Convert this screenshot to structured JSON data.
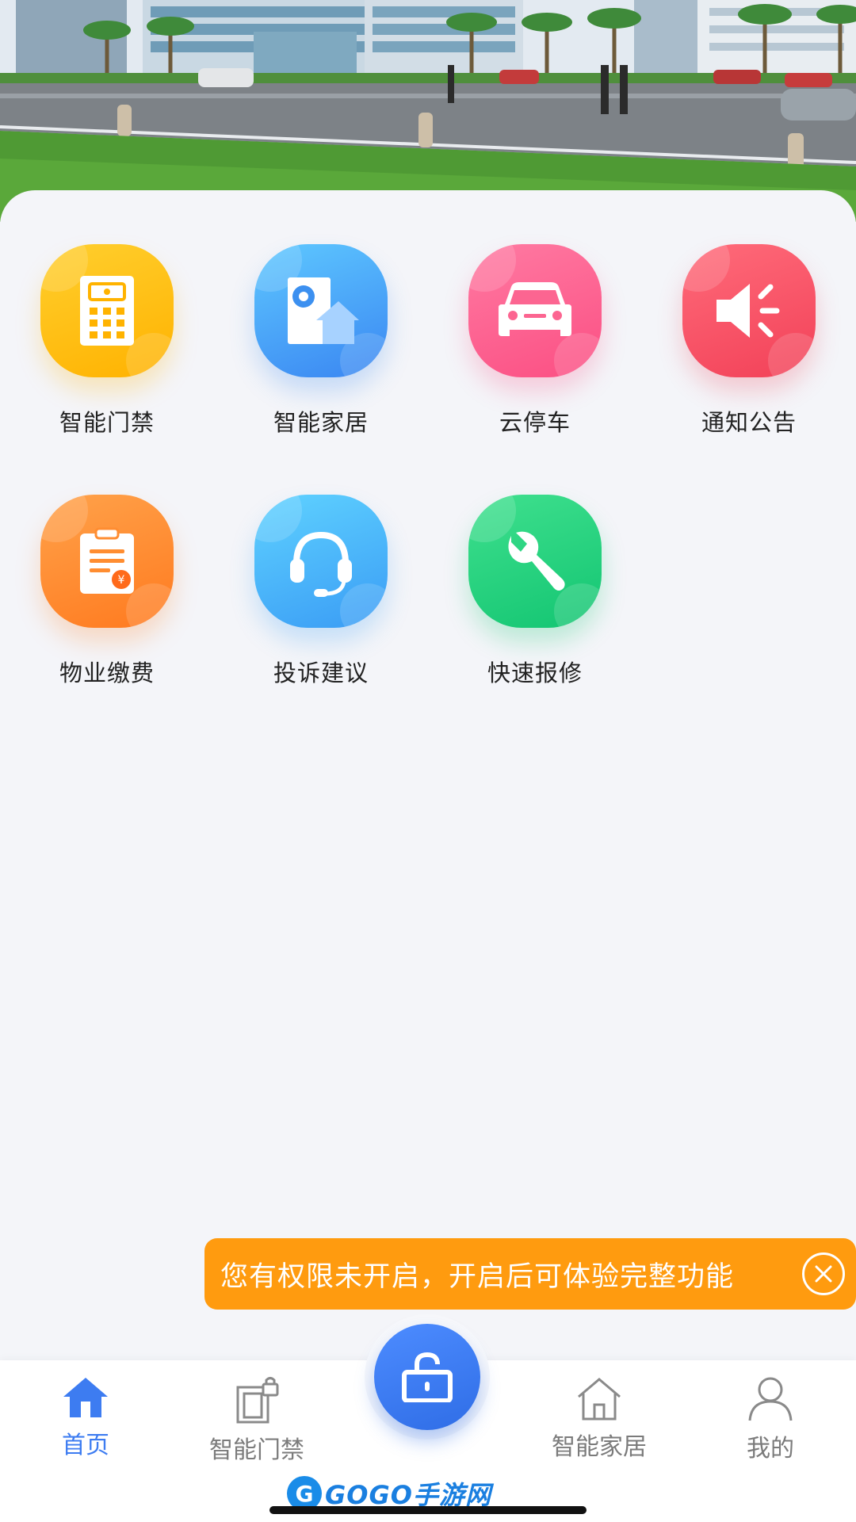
{
  "banner": {
    "image": "street-scene-office-buildings"
  },
  "services": [
    {
      "label": "智能门禁",
      "icon": "door-access-icon",
      "color": "#ffbf12"
    },
    {
      "label": "智能家居",
      "icon": "smart-home-icon",
      "color": "#43a2f7"
    },
    {
      "label": "云停车",
      "icon": "car-icon",
      "color": "#fc6591"
    },
    {
      "label": "通知公告",
      "icon": "speaker-icon",
      "color": "#f45468"
    },
    {
      "label": "物业缴费",
      "icon": "bill-icon",
      "color": "#ff8d31"
    },
    {
      "label": "投诉建议",
      "icon": "headset-icon",
      "color": "#48b4f9"
    },
    {
      "label": "快速报修",
      "icon": "wrench-icon",
      "color": "#22d27f"
    }
  ],
  "notice": {
    "text": "您有权限未开启，开启后可体验完整功能",
    "bg_color": "#ff9b0f"
  },
  "tabbar": {
    "items": [
      {
        "label": "首页",
        "icon": "home-icon",
        "active": true
      },
      {
        "label": "智能门禁",
        "icon": "door-access-icon",
        "active": false
      },
      {
        "label": "智能家居",
        "icon": "house-outline-icon",
        "active": false
      },
      {
        "label": "我的",
        "icon": "user-icon",
        "active": false
      }
    ],
    "center_icon": "unlock-icon",
    "active_color": "#3d7cf1"
  },
  "watermark": {
    "text": "GOGO手游网"
  }
}
